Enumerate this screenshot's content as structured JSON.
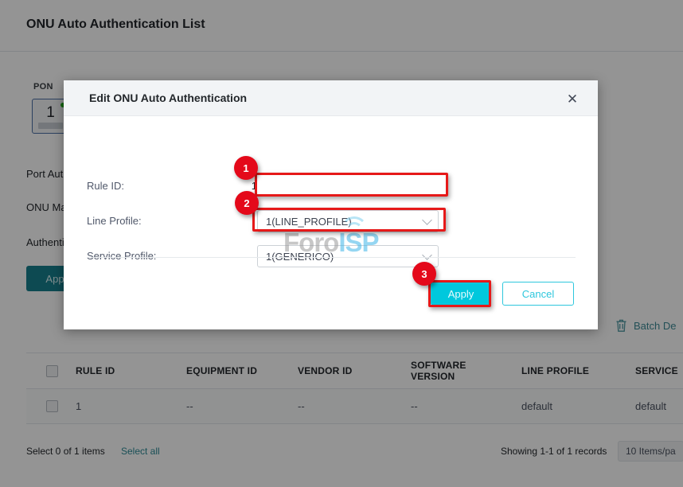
{
  "page": {
    "title": "ONU Auto Authentication List",
    "pon": {
      "label": "PON",
      "port_number": "1"
    },
    "form_rows": [
      {
        "label": "Port Aut"
      },
      {
        "label": "ONU Ma"
      },
      {
        "label": "Authenti"
      }
    ],
    "apply_button": "App",
    "batch_delete": {
      "label": "Batch De",
      "icon": "trash-icon"
    },
    "table": {
      "columns": [
        "RULE ID",
        "EQUIPMENT ID",
        "VENDOR ID",
        "SOFTWARE VERSION",
        "LINE PROFILE",
        "SERVICE"
      ],
      "rows": [
        {
          "rule_id": "1",
          "equipment_id": "--",
          "vendor_id": "--",
          "software_version": "--",
          "line_profile": "default",
          "service_profile": "default"
        }
      ]
    },
    "footer": {
      "select_count": "Select 0 of 1 items",
      "select_all": "Select all",
      "showing": "Showing 1-1 of 1 records",
      "per_page": "10 Items/pa"
    }
  },
  "modal": {
    "title": "Edit ONU Auto Authentication",
    "close_icon": "close-icon",
    "fields": {
      "rule_id_label": "Rule ID:",
      "rule_id_value": "1",
      "line_profile_label": "Line Profile:",
      "line_profile_value": "1(LINE_PROFILE)",
      "service_profile_label": "Service Profile:",
      "service_profile_value": "1(GENERICO)"
    },
    "buttons": {
      "apply": "Apply",
      "cancel": "Cancel"
    }
  },
  "annotations": {
    "badges": [
      "1",
      "2",
      "3"
    ],
    "highlight_color": "#e61919",
    "badge_color": "#e4091a"
  },
  "watermark": {
    "text_primary": "Foro",
    "text_accent": "ISP"
  },
  "colors": {
    "apply_accent": "#00c8dd",
    "cancel_accent": "#2ec7dd",
    "bg_apply": "#17808d",
    "link": "#2e8b96",
    "pon_status": "#27ae1e"
  }
}
